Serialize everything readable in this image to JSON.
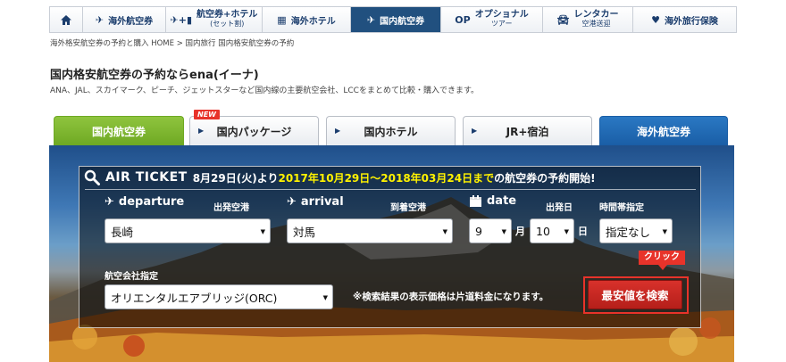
{
  "nav": {
    "items": [
      {
        "label": "海外航空券",
        "icon": "airplane-icon"
      },
      {
        "label": "航空券+ホテル",
        "sub": "(セット割)",
        "icon": "plane-hotel-icon"
      },
      {
        "label": "海外ホテル",
        "icon": "hotel-icon"
      },
      {
        "label": "国内航空券",
        "icon": "domestic-flight-icon",
        "active": true
      },
      {
        "label": "オプショナル",
        "sub": "ツアー",
        "prefix": "OP"
      },
      {
        "label": "レンタカー",
        "sub": "空港送迎",
        "icon": "car-icon"
      },
      {
        "label": "海外旅行保険",
        "icon": "heart-icon"
      }
    ]
  },
  "breadcrumb": "海外格安航空券の予約と購入 HOME > 国内旅行 国内格安航空券の予約",
  "heading": {
    "title": "国内格安航空券の予約ならena(イーナ)",
    "subtitle": "ANA、JAL、スカイマーク、ピーチ、ジェットスターなど国内線の主要航空会社、LCCをまとめて比較・購入できます。"
  },
  "tabs": [
    "国内航空券",
    "国内パッケージ",
    "国内ホテル",
    "JR+宿泊",
    "海外航空券"
  ],
  "new_badge": "NEW",
  "search": {
    "label": "AIR TICKET",
    "msg_before": "8月29日(火)より",
    "msg_highlight": "2017年10月29日〜2018年03月24日まで",
    "msg_after": "の航空券の予約開始!",
    "departure_label": "departure",
    "departure_jp": "出発空港",
    "arrival_label": "arrival",
    "arrival_jp": "到着空港",
    "date_label": "date",
    "date_jp": "出発日",
    "time_jp": "時間帯指定",
    "departure_value": "長崎",
    "arrival_value": "対馬",
    "month_value": "9",
    "month_unit": "月",
    "day_value": "10",
    "day_unit": "日",
    "time_value": "指定なし",
    "airline_label": "航空会社指定",
    "airline_value": "オリエンタルエアブリッジ(ORC)",
    "note": "※検索結果の表示価格は片道料金になります。",
    "button": "最安値を検索",
    "click_tag": "クリック"
  },
  "colors": {
    "nav_active": "#21507f",
    "tab_green": "#7ab530",
    "tab_blue": "#1f68b1",
    "highlight": "#fff200",
    "button_red": "#c9261f"
  }
}
